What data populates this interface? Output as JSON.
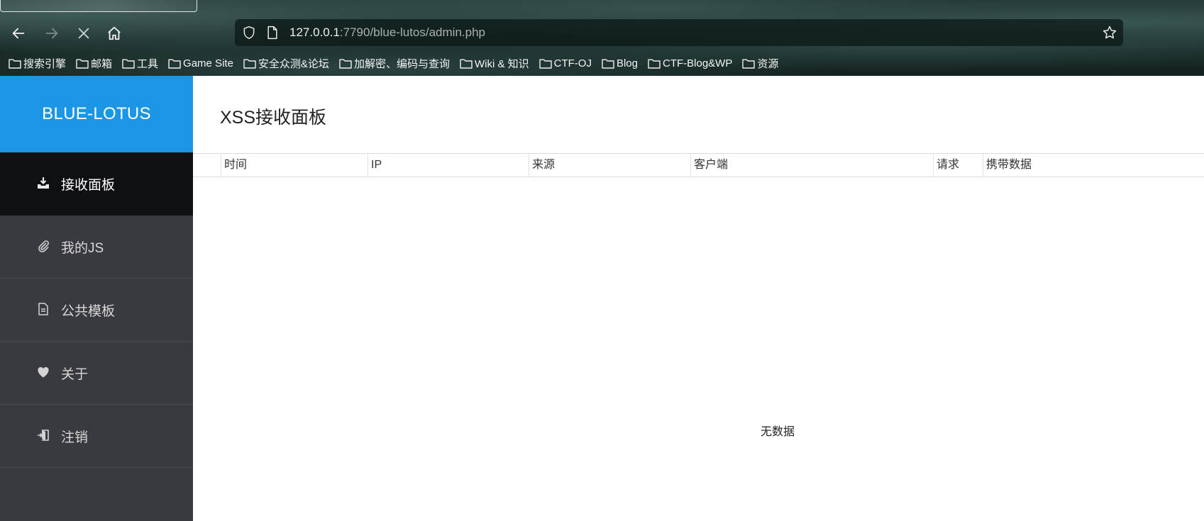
{
  "browser": {
    "url_host": "127.0.0.1",
    "url_rest": ":7790/blue-lutos/admin.php",
    "bookmarks": [
      {
        "label": "搜索引擎"
      },
      {
        "label": "邮箱"
      },
      {
        "label": "工具"
      },
      {
        "label": "Game Site"
      },
      {
        "label": "安全众测&论坛"
      },
      {
        "label": "加解密、编码与查询"
      },
      {
        "label": "Wiki & 知识"
      },
      {
        "label": "CTF-OJ"
      },
      {
        "label": "Blog"
      },
      {
        "label": "CTF-Blog&WP"
      },
      {
        "label": "资源"
      }
    ]
  },
  "sidebar": {
    "brand": "BLUE-LOTUS",
    "items": [
      {
        "label": "接收面板",
        "icon": "download-tray-icon",
        "active": true
      },
      {
        "label": "我的JS",
        "icon": "paperclip-icon"
      },
      {
        "label": "公共模板",
        "icon": "document-icon"
      },
      {
        "label": "关于",
        "icon": "heart-icon"
      },
      {
        "label": "注销",
        "icon": "logout-icon"
      }
    ]
  },
  "main": {
    "title": "XSS接收面板",
    "columns": [
      "时间",
      "IP",
      "来源",
      "客户端",
      "请求",
      "携带数据"
    ],
    "empty_text": "无数据"
  },
  "colors": {
    "brand": "#1a96e4",
    "sidebar_bg": "#393a3f",
    "sidebar_active": "#0f1013"
  }
}
